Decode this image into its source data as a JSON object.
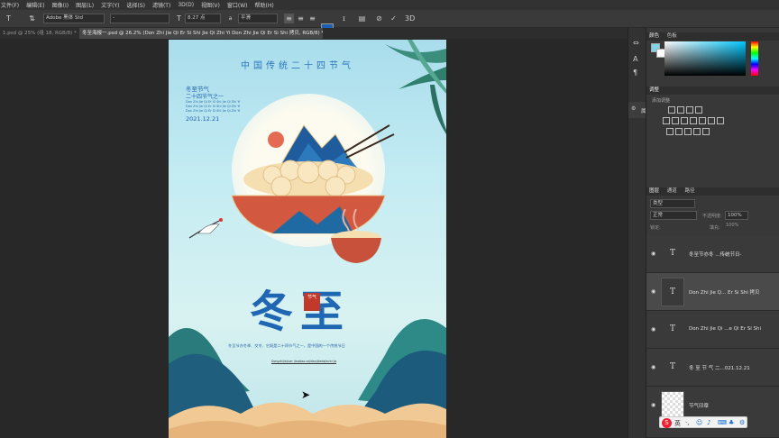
{
  "menubar": {
    "items": [
      "文件(F)",
      "编辑(E)",
      "图像(I)",
      "图层(L)",
      "文字(Y)",
      "选择(S)",
      "滤镜(T)",
      "3D(D)",
      "视图(V)",
      "窗口(W)",
      "帮助(H)"
    ]
  },
  "options": {
    "font_family": "Adobe 黑体 Std",
    "font_style": "-",
    "font_size": "8.27 点",
    "antialias": "平滑"
  },
  "tabs": {
    "inactive": "1.psd @ 25% (组 18, RGB/8) *",
    "active": "冬至海报一.psd @ 26.2% (Don Zhi Jie Qi Er Si Shi Jie Qi Zhi Yi Don Zhi Jie Qi Er Si Shi 拷贝, RGB/8) *"
  },
  "poster": {
    "top_title": "中国传统二十四节气",
    "subtitle_cn": "冬至节气",
    "subtitle_cn2": "二十四节气之一",
    "pinyin_lines": [
      "Don Zhi Jie Qi Er Si Shi Jie Qi Zhi Yi",
      "Don Zhi Jie Qi Er Si Shi Jie Qi Zhi Yi",
      "Don Zhi Jie Qi Er Si Shi Jie Qi Zhi Yi"
    ],
    "date": "2021.12.21",
    "main_title": "冬至",
    "seal": "节气",
    "description": "冬至节亦冬季、交冬、它既是二十四节气之一，是中国的一个传统节日",
    "description_en": "Dongzhijiejiuer jieqibao zajidanjijiedajiezhi jia"
  },
  "dock": {
    "properties_label": "属性"
  },
  "color_panel": {
    "tabs": [
      "颜色",
      "色板"
    ]
  },
  "adjust_panel": {
    "title": "调整",
    "sub": "添加调整"
  },
  "layers_panel": {
    "tabs": [
      "图层",
      "通道",
      "路径"
    ],
    "kind": "类型",
    "blend_mode": "正常",
    "opacity_label": "不透明度:",
    "opacity": "100%",
    "lock_label": "锁定:",
    "fill_label": "填充:",
    "fill": "100%",
    "layers": [
      {
        "name": "冬至节亦冬 ...传统节日-",
        "type": "text"
      },
      {
        "name": "Don Zhi Jie Q... Er Si Shi 拷贝",
        "type": "text"
      },
      {
        "name": "Don Zhi Jie Qi ...e Qi Er Si Shi",
        "type": "text"
      },
      {
        "name": "冬 至 节 气 二...021.12.21",
        "type": "text"
      },
      {
        "name": "节气印章",
        "type": "image"
      }
    ]
  },
  "ime": {
    "label": "英"
  },
  "colors": {
    "accent_blue": "#2a6fd1",
    "poster_blue": "#1d69b4",
    "seal_red": "#c0392b"
  }
}
